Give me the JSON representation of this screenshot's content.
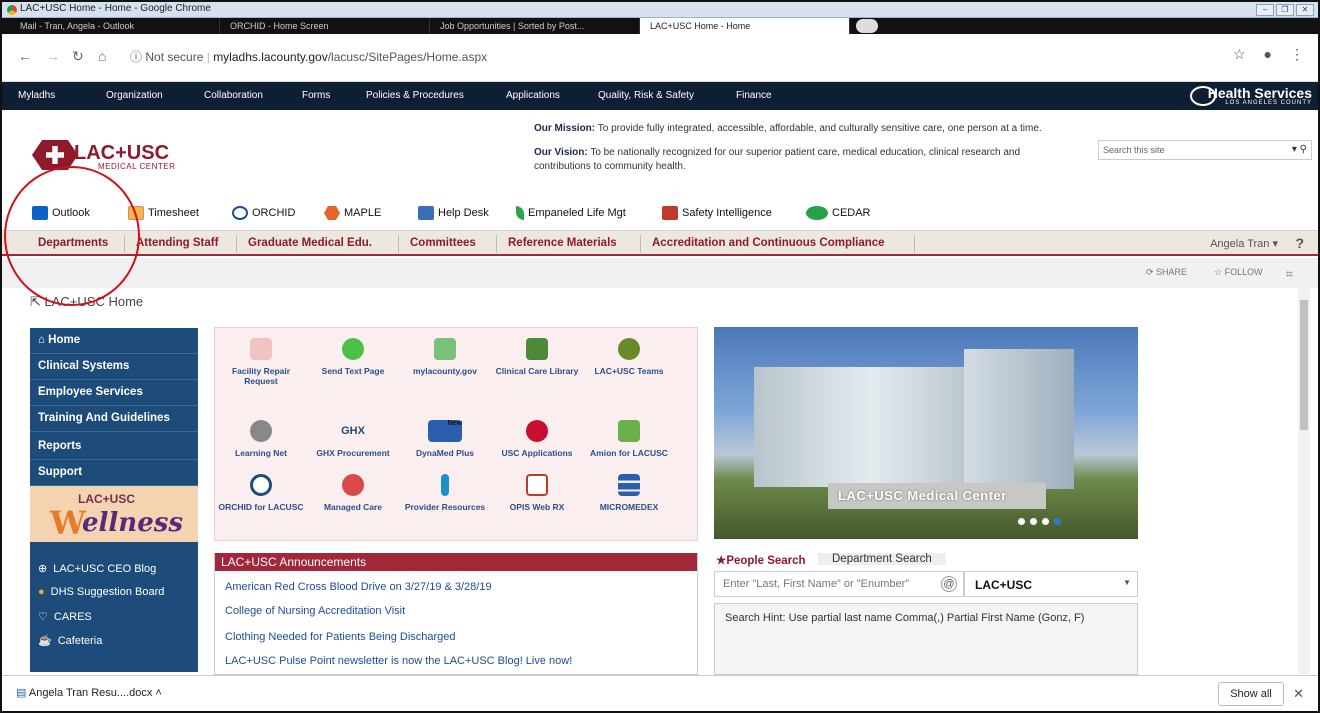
{
  "window": {
    "title": "LAC+USC Home - Home - Google Chrome"
  },
  "tabs": [
    {
      "label": "Mail - Tran, Angela - Outlook"
    },
    {
      "label": "ORCHID - Home Screen"
    },
    {
      "label": "Job Opportunities | Sorted by Post..."
    },
    {
      "label": "LAC+USC Home - Home"
    }
  ],
  "address": {
    "security": "Not secure",
    "url_domain": "myladhs.lacounty.gov",
    "url_path": "/lacusc/SitePages/Home.aspx"
  },
  "topnav": [
    "Myladhs",
    "Organization",
    "Collaboration",
    "Forms",
    "Policies & Procedures",
    "Applications",
    "Quality, Risk & Safety",
    "Finance"
  ],
  "brand": {
    "health_services": "Health Services",
    "la_county": "LOS ANGELES COUNTY",
    "logo_main": "LAC+USC",
    "logo_sub": "MEDICAL CENTER"
  },
  "mission": {
    "mission_label": "Our Mission:",
    "mission_text": " To provide fully integrated, accessible, affordable, and culturally sensitive care, one person at a time.",
    "vision_label": "Our Vision:",
    "vision_text": " To be nationally recognized for our superior patient care, medical education, clinical research and contributions to community health."
  },
  "search": {
    "placeholder": "Search this site"
  },
  "quicklinks": [
    "Outlook",
    "Timesheet",
    "ORCHID",
    "MAPLE",
    "Help Desk",
    "Empaneled Life Mgt",
    "Safety Intelligence",
    "CEDAR"
  ],
  "dept_tabs": [
    "Departments",
    "Attending Staff",
    "Graduate Medical Edu.",
    "Committees",
    "Reference Materials",
    "Accreditation and Continuous Compliance"
  ],
  "user": {
    "name": "Angela Tran",
    "help": "?"
  },
  "sharebar": {
    "share": "SHARE",
    "follow": "FOLLOW"
  },
  "breadcrumb": "LAC+USC Home",
  "leftnav": [
    "Home",
    "Clinical Systems",
    "Employee Services",
    "Training And Guidelines",
    "Reports",
    "Support"
  ],
  "wellness": {
    "top": "LAC+USC",
    "word": "ellness",
    "initial": "W"
  },
  "leftlinks": [
    "LAC+USC CEO Blog",
    "DHS Suggestion Board",
    "CARES",
    "Cafeteria"
  ],
  "apps": [
    "Facility Repair Request",
    "Send Text Page",
    "mylacounty.gov",
    "Clinical Care Library",
    "LAC+USC Teams",
    "Learning Net",
    "GHX Procurement",
    "DynaMed Plus",
    "USC Applications",
    "Amion for LACUSC",
    "ORCHID for LACUSC",
    "Managed Care",
    "Provider Resources",
    "OPIS Web RX",
    "MICROMEDEX"
  ],
  "app_icon_text": {
    "ghx": "GHX",
    "new": "New"
  },
  "announcements": {
    "title": "LAC+USC Announcements",
    "items": [
      "American Red Cross Blood Drive on 3/27/19 & 3/28/19",
      "College of Nursing Accreditation Visit",
      "Clothing Needed for Patients Being Discharged",
      "LAC+USC Pulse Point newsletter is now the LAC+USC Blog! Live now!"
    ]
  },
  "photo": {
    "sign": "LAC+USC Medical Center"
  },
  "people_search": {
    "tab1": "People Search",
    "tab2": "Department Search",
    "placeholder": "Enter \"Last, First Name\" or \"Enumber\"",
    "select_value": "LAC+USC",
    "hint": "Search Hint: Use partial last name Comma(,) Partial First Name (Gonz, F)"
  },
  "download": {
    "file": "Angela Tran Resu....docx",
    "show_all": "Show all"
  },
  "colors": {
    "accent_red": "#a2273a",
    "nav_blue": "#1e4c7a",
    "topnav_dark": "#0f1f33"
  }
}
